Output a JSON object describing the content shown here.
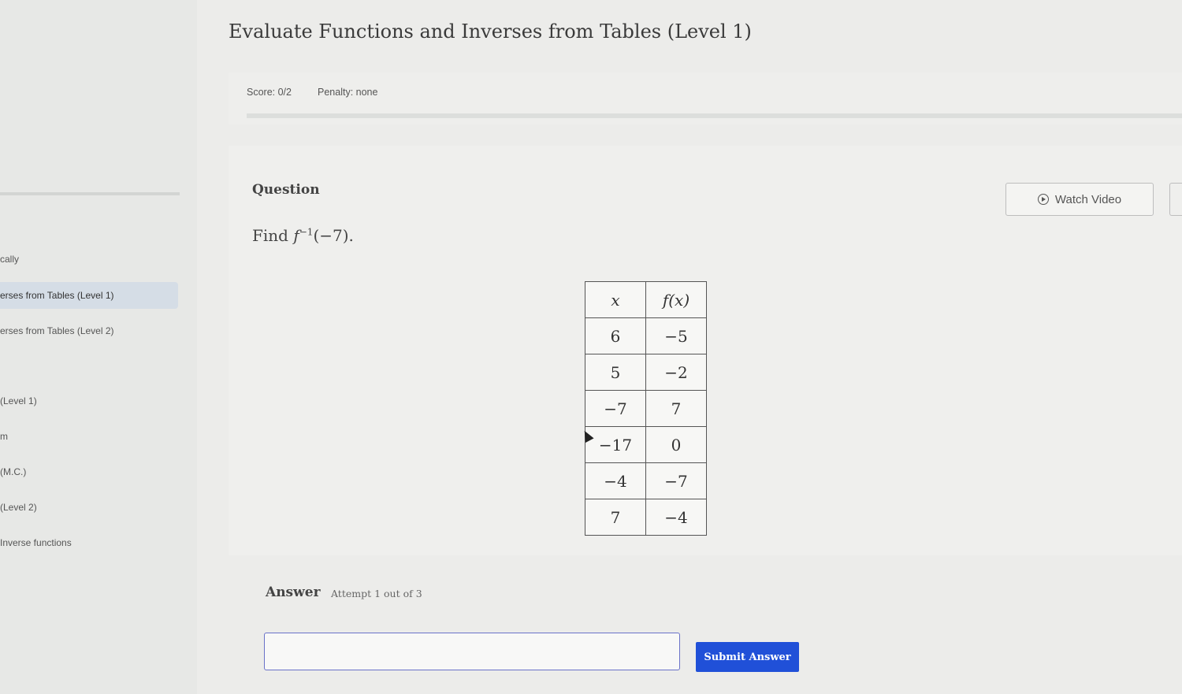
{
  "page": {
    "title": "Evaluate Functions and Inverses from Tables (Level 1)"
  },
  "sidebar": {
    "items": [
      {
        "label": "cally",
        "active": false
      },
      {
        "label": "erses from Tables (Level 1)",
        "active": true
      },
      {
        "label": "erses from Tables (Level 2)",
        "active": false
      },
      {
        "label": "(Level 1)",
        "active": false
      },
      {
        "label": "m",
        "active": false
      },
      {
        "label": "(M.C.)",
        "active": false
      },
      {
        "label": "(Level 2)",
        "active": false
      },
      {
        "label": "Inverse functions",
        "active": false
      }
    ]
  },
  "scorebar": {
    "score": "Score: 0/2",
    "penalty": "Penalty: none"
  },
  "question": {
    "label": "Question",
    "watch_video": "Watch Video",
    "text_prefix": "Find ",
    "func": "f",
    "superscript": "−1",
    "argument": "(−7)."
  },
  "table": {
    "headers": [
      "x",
      "f(x)"
    ],
    "rows": [
      [
        "6",
        "−5"
      ],
      [
        "5",
        "−2"
      ],
      [
        "−7",
        "7"
      ],
      [
        "−17",
        "0"
      ],
      [
        "−4",
        "−7"
      ],
      [
        "7",
        "−4"
      ]
    ]
  },
  "answer": {
    "label": "Answer",
    "attempt": "Attempt 1 out of 3",
    "input_value": "",
    "submit_label": "Submit Answer"
  },
  "colors": {
    "submit_bg": "#2050d8",
    "input_border": "#6a72c8",
    "active_sidebar": "#d5dde6"
  }
}
